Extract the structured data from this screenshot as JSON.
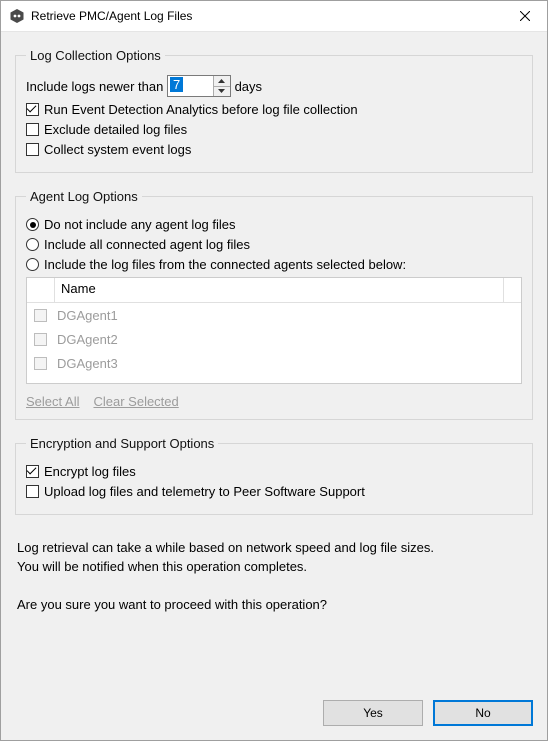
{
  "window": {
    "title": "Retrieve PMC/Agent Log Files"
  },
  "log_collection": {
    "legend": "Log Collection Options",
    "include_newer_prefix": "Include logs newer than",
    "include_newer_days": "7",
    "include_newer_suffix": "days",
    "run_analytics": {
      "label": "Run Event Detection Analytics before log file collection",
      "checked": true
    },
    "exclude_detailed": {
      "label": "Exclude detailed log files",
      "checked": false
    },
    "collect_system": {
      "label": "Collect system event logs",
      "checked": false
    }
  },
  "agent_log": {
    "legend": "Agent Log Options",
    "radio_none": {
      "label": "Do not include any agent log files",
      "selected": true
    },
    "radio_all": {
      "label": "Include all connected agent log files",
      "selected": false
    },
    "radio_selected": {
      "label": "Include the log files from the connected agents selected below:",
      "selected": false
    },
    "table": {
      "header_name": "Name",
      "rows": [
        {
          "name": "DGAgent1",
          "checked": false
        },
        {
          "name": "DGAgent2",
          "checked": false
        },
        {
          "name": "DGAgent3",
          "checked": false
        }
      ]
    },
    "select_all": "Select All",
    "clear_selected": "Clear Selected"
  },
  "encryption": {
    "legend": "Encryption and Support Options",
    "encrypt": {
      "label": "Encrypt log files",
      "checked": true
    },
    "upload": {
      "label": "Upload log files and telemetry to Peer Software Support",
      "checked": false
    }
  },
  "footer": {
    "info_line1": "Log retrieval can take a while based on network speed and log file sizes.",
    "info_line2": "You will be notified when this operation completes.",
    "confirm": "Are you sure you want to proceed with this operation?",
    "yes": "Yes",
    "no": "No"
  }
}
